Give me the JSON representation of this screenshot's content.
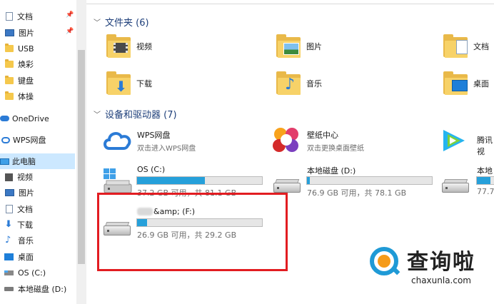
{
  "sidebar": {
    "items": [
      {
        "label": "文档",
        "icon": "document-icon",
        "pinned": true
      },
      {
        "label": "图片",
        "icon": "pictures-icon",
        "pinned": true
      },
      {
        "label": "USB",
        "icon": "folder-icon"
      },
      {
        "label": "焕彩",
        "icon": "folder-icon"
      },
      {
        "label": "键盘",
        "icon": "folder-icon"
      },
      {
        "label": "体操",
        "icon": "folder-icon"
      },
      {
        "label": "OneDrive",
        "icon": "onedrive-icon"
      },
      {
        "label": "WPS网盘",
        "icon": "wps-cloud-icon"
      },
      {
        "label": "此电脑",
        "icon": "this-pc-icon",
        "selected": true
      },
      {
        "label": "视频",
        "icon": "videos-icon"
      },
      {
        "label": "图片",
        "icon": "pictures-icon"
      },
      {
        "label": "文档",
        "icon": "document-icon"
      },
      {
        "label": "下载",
        "icon": "download-icon"
      },
      {
        "label": "音乐",
        "icon": "music-icon"
      },
      {
        "label": "桌面",
        "icon": "desktop-icon"
      },
      {
        "label": "OS (C:)",
        "icon": "os-drive-icon"
      },
      {
        "label": "本地磁盘 (D:)",
        "icon": "drive-icon"
      }
    ]
  },
  "folders_section": {
    "title": "文件夹 (6)",
    "folders": [
      {
        "label": "视频"
      },
      {
        "label": "图片"
      },
      {
        "label": "文档"
      },
      {
        "label": "下载"
      },
      {
        "label": "音乐"
      },
      {
        "label": "桌面"
      }
    ]
  },
  "devices_section": {
    "title": "设备和驱动器 (7)",
    "apps": [
      {
        "name": "WPS网盘",
        "subtitle": "双击进入WPS网盘"
      },
      {
        "name": "壁纸中心",
        "subtitle": "双击更换桌面壁纸"
      },
      {
        "name": "腾讯视"
      }
    ],
    "drives": [
      {
        "name": "OS (C:)",
        "usage": "37.2 GB 可用，共 81.1 GB",
        "used_fraction": 0.54
      },
      {
        "name": "本地磁盘 (D:)",
        "usage": "76.9 GB 可用，共 78.1 GB",
        "used_fraction": 0.02
      },
      {
        "name": "本地",
        "usage": "77.7",
        "used_fraction": 0.5
      },
      {
        "name": "&amp; (F:)",
        "usage": "26.9 GB 可用，共 29.2 GB",
        "used_fraction": 0.08
      }
    ]
  },
  "watermark": {
    "brand": "查询啦",
    "url": "chaxunla.com"
  },
  "colors": {
    "accent": "#26a0da",
    "highlight": "#e21c21",
    "selected": "#cce8ff",
    "section_title": "#1e3f7a"
  }
}
